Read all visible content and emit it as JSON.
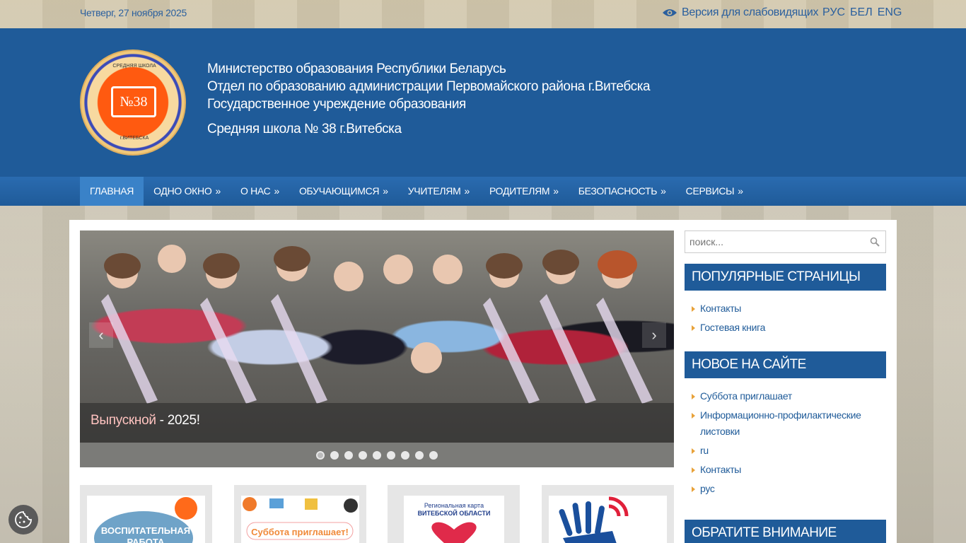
{
  "topbar": {
    "date": "Четверг, 27 ноября 2025",
    "vision_link": "Версия для слабовидящих",
    "langs": [
      "РУС",
      "БЕЛ",
      "ENG"
    ]
  },
  "header": {
    "line1": "Министерство образования Республики Беларусь",
    "line2": "Отдел по образованию администрации Первомайского района г.Витебска",
    "line3": "Государственное учреждение образования",
    "school": "Средняя школа № 38 г.Витебска",
    "logo_text": "№38",
    "logo_top": "СРЕДНЯЯ ШКОЛА",
    "logo_bottom": "г.ВИТЕБСКА"
  },
  "nav": {
    "items": [
      {
        "label": "Главная",
        "arrow": ""
      },
      {
        "label": "Одно окно",
        "arrow": "»"
      },
      {
        "label": "О нас",
        "arrow": "»"
      },
      {
        "label": "Обучающимся",
        "arrow": "»"
      },
      {
        "label": "Учителям",
        "arrow": "»"
      },
      {
        "label": "Родителям",
        "arrow": "»"
      },
      {
        "label": "Безопасность",
        "arrow": "»"
      },
      {
        "label": "Сервисы",
        "arrow": "»"
      }
    ]
  },
  "slider": {
    "caption_em": "Выпускной",
    "caption_rest": " - 2025!",
    "prev": "‹",
    "next": "›",
    "dot_count": 9
  },
  "cards": [
    {
      "title": "ВОСПИТАТЕЛЬНАЯ РАБОТА"
    },
    {
      "title": "Суббота приглашает!"
    },
    {
      "title": "Региональная карта ВИТЕБСКОЙ ОБЛАСТИ"
    },
    {
      "title": ""
    }
  ],
  "sidebar": {
    "search_placeholder": "поиск...",
    "popular_title": "Популярные страницы",
    "popular": [
      "Контакты",
      "Гостевая книга"
    ],
    "new_title": "Новое на сайте",
    "new_items": [
      "Суббота приглашает",
      "Информационно-профилактические листовки",
      "ru",
      "Контакты",
      "рус"
    ],
    "attention_title": "Обратите внимание"
  },
  "colors": {
    "brand": "#1f5b99",
    "accent": "#e8a23a"
  }
}
